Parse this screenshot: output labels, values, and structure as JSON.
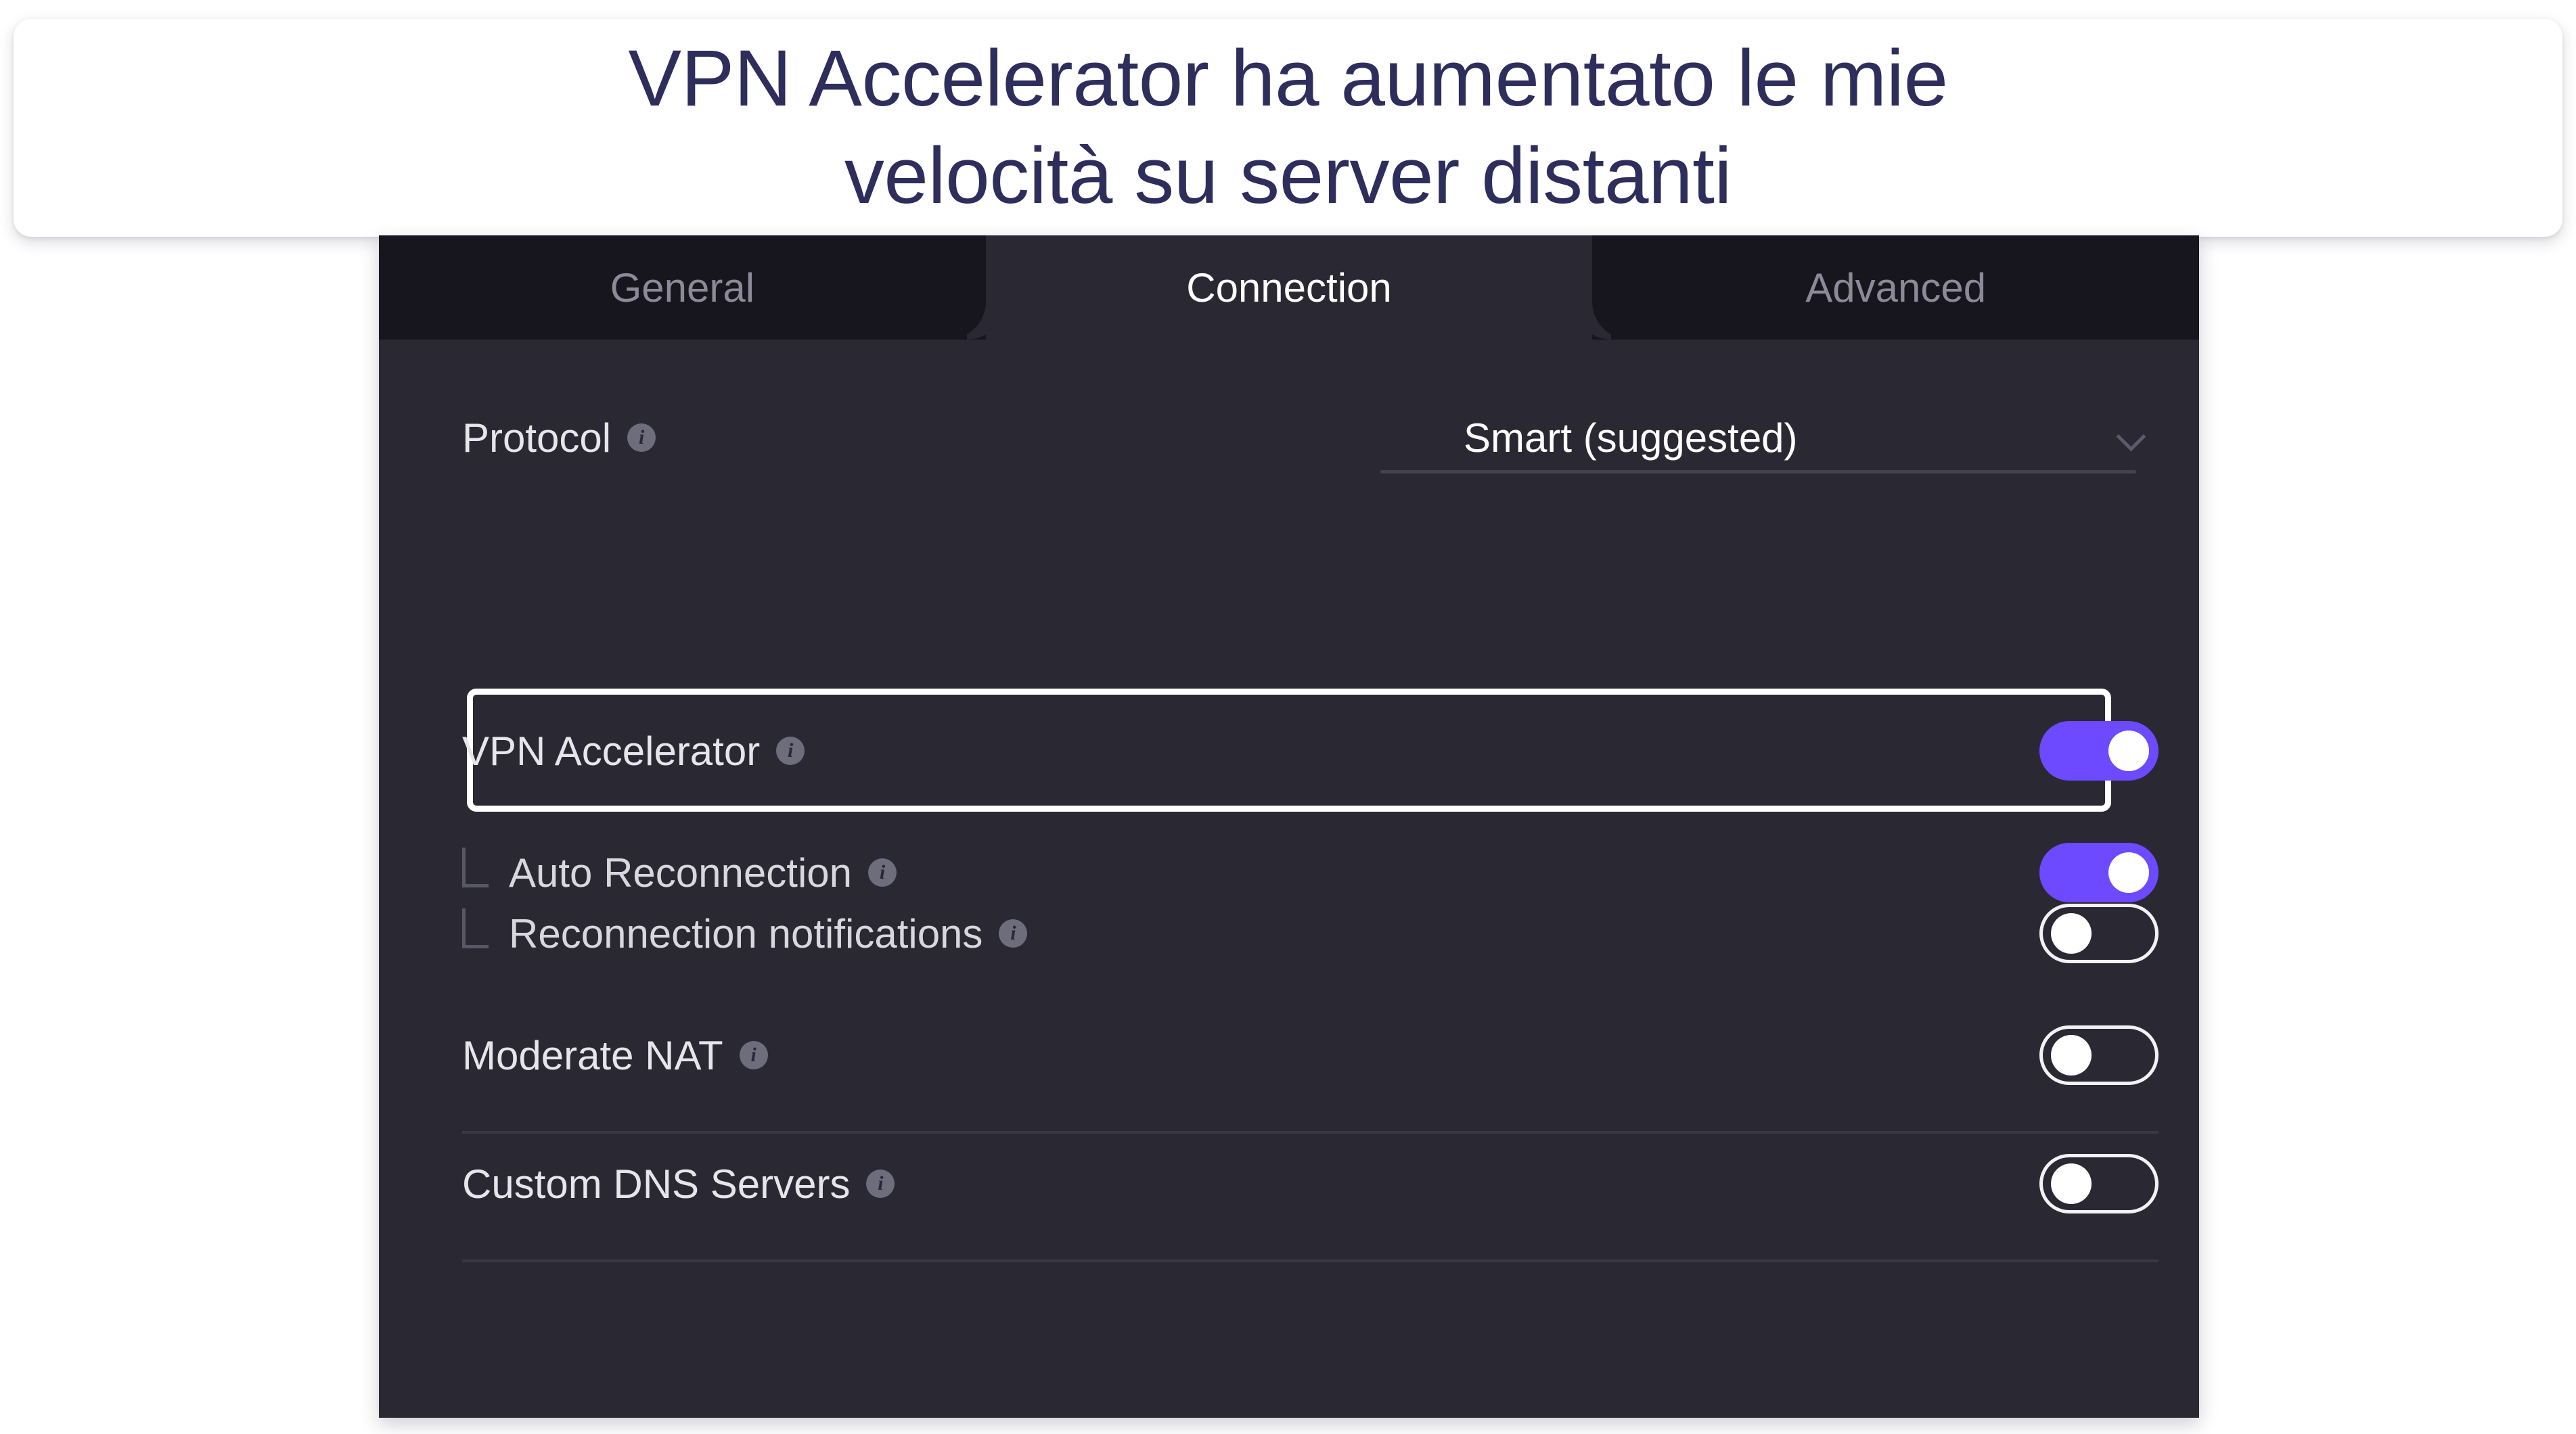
{
  "caption": {
    "text": "VPN Accelerator ha aumentato le mie\nvelocità su server distanti",
    "color": "#2e2e5c"
  },
  "window": {
    "tabs": [
      {
        "label": "General",
        "active": false
      },
      {
        "label": "Connection",
        "active": true
      },
      {
        "label": "Advanced",
        "active": false
      }
    ],
    "background": "#2a2833",
    "tabbar_background": "#17161f"
  },
  "settings": {
    "protocol": {
      "label": "Protocol",
      "info_icon": "info-icon",
      "value": "Smart (suggested)",
      "chevron_icon": "chevron-down-icon"
    },
    "rows": [
      {
        "id": "vpn-accelerator",
        "label": "VPN Accelerator",
        "info_icon": "info-icon",
        "toggle": "on",
        "indented": false,
        "highlighted": true
      },
      {
        "id": "auto-reconnection",
        "label": "Auto Reconnection",
        "info_icon": "info-icon",
        "toggle": "on",
        "indented": true,
        "highlighted": false
      },
      {
        "id": "reconnection-notifications",
        "label": "Reconnection notifications",
        "info_icon": "info-icon",
        "toggle": "off",
        "indented": true,
        "highlighted": false
      },
      {
        "id": "moderate-nat",
        "label": "Moderate NAT",
        "info_icon": "info-icon",
        "toggle": "off",
        "indented": false,
        "highlighted": false
      },
      {
        "id": "custom-dns-servers",
        "label": "Custom DNS Servers",
        "info_icon": "info-icon",
        "toggle": "off",
        "indented": false,
        "highlighted": false
      }
    ]
  },
  "colors": {
    "toggle_on": "#6d4aff",
    "toggle_off_border": "#f2f2f5",
    "knob": "#ffffff",
    "highlight_border": "#ffffff",
    "info_icon_bg": "#6e6d7c",
    "divider": "#3a3845",
    "text_primary": "#e6e5ea",
    "text_muted": "#8c8a99"
  },
  "icon_glyphs": {
    "info": "i"
  }
}
